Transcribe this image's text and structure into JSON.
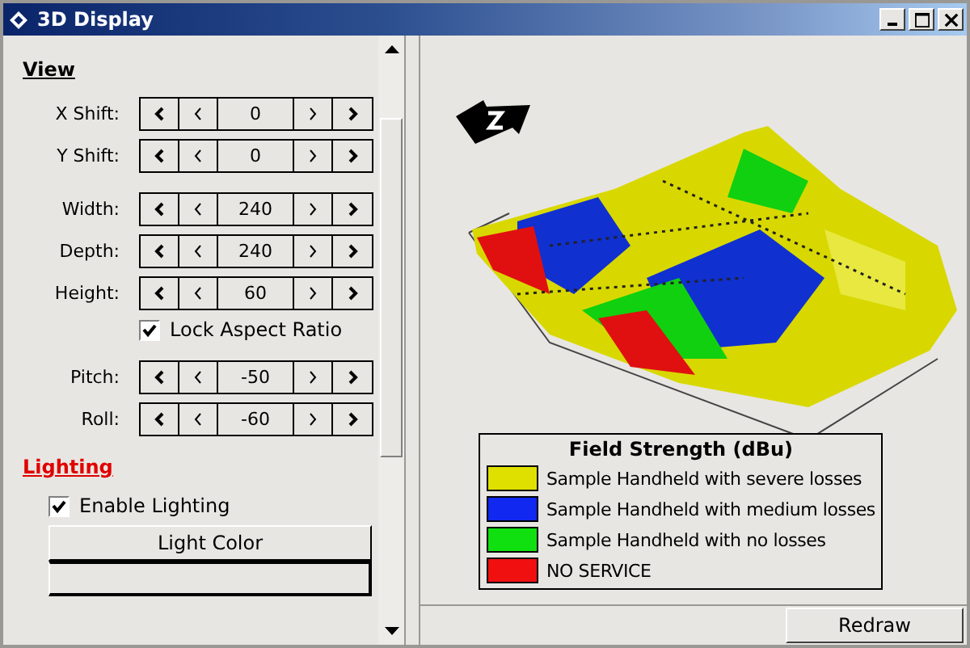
{
  "window": {
    "title": "3D Display"
  },
  "sections": [
    {
      "title": "View",
      "selected": false,
      "groups": [
        [
          {
            "kind": "spinner",
            "label": "X Shift:",
            "value": "0"
          },
          {
            "kind": "spinner",
            "label": "Y Shift:",
            "value": "0"
          }
        ],
        [
          {
            "kind": "spinner",
            "label": "Width:",
            "value": "240"
          },
          {
            "kind": "spinner",
            "label": "Depth:",
            "value": "240"
          },
          {
            "kind": "spinner",
            "label": "Height:",
            "value": "60"
          },
          {
            "kind": "checkbox",
            "label": "Lock Aspect Ratio",
            "checked": true
          }
        ],
        [
          {
            "kind": "spinner",
            "label": "Pitch:",
            "value": "-50"
          },
          {
            "kind": "spinner",
            "label": "Roll:",
            "value": "-60"
          }
        ]
      ]
    },
    {
      "title": "Lighting",
      "selected": true,
      "groups": [
        [
          {
            "kind": "checkbox",
            "label": "Enable Lighting",
            "checked": true
          },
          {
            "kind": "button",
            "label": "Light Color"
          },
          {
            "kind": "swatch"
          }
        ]
      ]
    }
  ],
  "legend": {
    "title": "Field Strength (dBu)",
    "items": [
      {
        "label": "Sample Handheld with severe losses",
        "color": "#e0e000"
      },
      {
        "label": "Sample Handheld with medium losses",
        "color": "#1028f0"
      },
      {
        "label": "Sample Handheld with no losses",
        "color": "#10e010"
      },
      {
        "label": "NO SERVICE",
        "color": "#f01010"
      }
    ]
  },
  "redraw_button": "Redraw"
}
